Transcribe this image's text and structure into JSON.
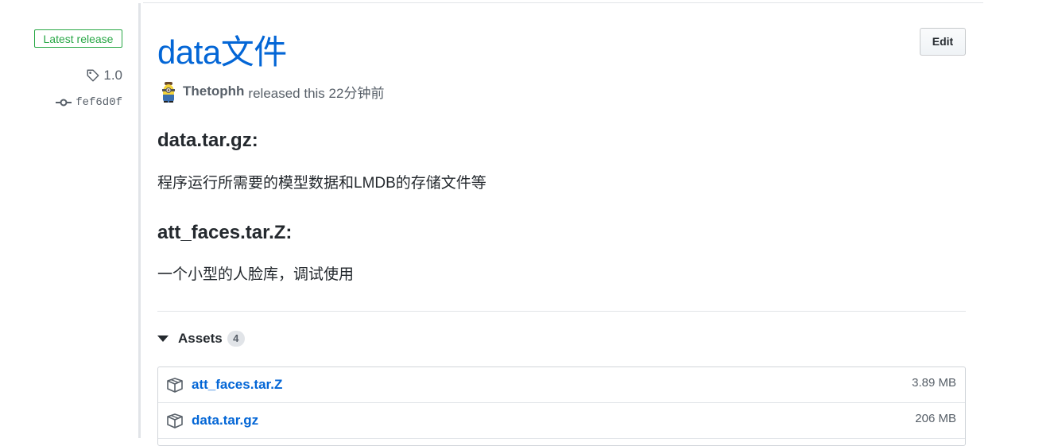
{
  "sidebar": {
    "badge": "Latest release",
    "tag": "1.0",
    "commit": "fef6d0f"
  },
  "release": {
    "title": "data文件",
    "edit_label": "Edit",
    "author": "Thetophh",
    "released_text": "released this 22分钟前"
  },
  "notes": [
    {
      "heading": "data.tar.gz:",
      "text": "程序运行所需要的模型数据和LMDB的存储文件等"
    },
    {
      "heading": "att_faces.tar.Z:",
      "text": "一个小型的人脸库，调试使用"
    }
  ],
  "assets": {
    "label": "Assets",
    "count": "4",
    "items": [
      {
        "name": "att_faces.tar.Z",
        "size": "3.89 MB"
      },
      {
        "name": "data.tar.gz",
        "size": "206 MB"
      }
    ]
  },
  "colors": {
    "link": "#0366d6",
    "badge_green": "#28a745",
    "muted": "#586069"
  },
  "icons": [
    "tag-icon",
    "commit-icon",
    "package-icon",
    "triangle-down-icon"
  ]
}
